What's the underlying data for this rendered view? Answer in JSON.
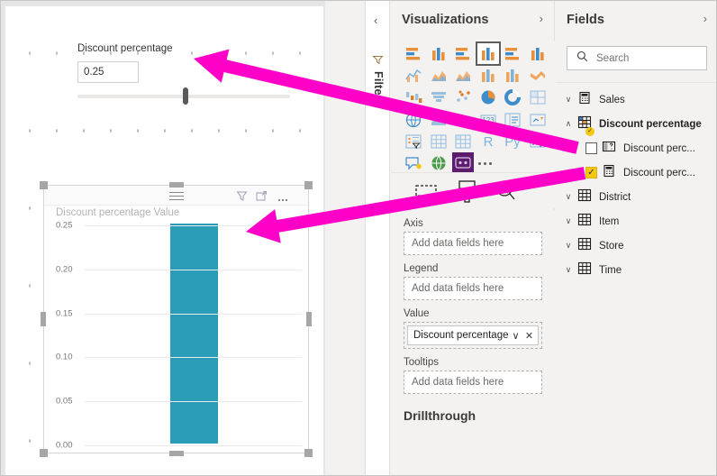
{
  "canvas": {
    "slicer": {
      "name": "slicer-visual",
      "title": "Discount percentage",
      "value": "0.25",
      "placeholder": "0.25"
    },
    "chart_visual": {
      "title": "Discount percentage Value",
      "header_icons": [
        "drag-handle-icon",
        "filter-icon",
        "focus-mode-icon",
        "more-options-icon"
      ]
    }
  },
  "chart_data": {
    "type": "bar",
    "title": "Discount percentage Value",
    "categories": [
      ""
    ],
    "values": [
      0.25
    ],
    "series": [
      {
        "name": "Discount percentage Value",
        "values": [
          0.25
        ]
      }
    ],
    "xlabel": "",
    "ylabel": "",
    "ylim": [
      0.0,
      0.25
    ],
    "yticks": [
      "0.00",
      "0.05",
      "0.10",
      "0.15",
      "0.20",
      "0.25"
    ],
    "ytick_values": [
      0.0,
      0.05,
      0.1,
      0.15,
      0.2,
      0.25
    ],
    "grid": true,
    "legend": "none",
    "bar_color": "#2b9cb8"
  },
  "filters_rail": {
    "collapse_label": "‹",
    "label": "Filters",
    "funnel_icon": "filter-icon"
  },
  "visualizations": {
    "title": "Visualizations",
    "expand_label": "›",
    "icons": [
      {
        "name": "stacked-bar-chart-icon",
        "selected": false
      },
      {
        "name": "stacked-column-chart-icon",
        "selected": false
      },
      {
        "name": "clustered-bar-chart-icon",
        "selected": false
      },
      {
        "name": "clustered-column-chart-icon",
        "selected": true
      },
      {
        "name": "hundred-percent-stacked-bar-chart-icon",
        "selected": false
      },
      {
        "name": "hundred-percent-stacked-column-chart-icon",
        "selected": false
      },
      {
        "name": "line-chart-icon",
        "selected": false
      },
      {
        "name": "area-chart-icon",
        "selected": false
      },
      {
        "name": "stacked-area-chart-icon",
        "selected": false
      },
      {
        "name": "line-and-stacked-column-chart-icon",
        "selected": false
      },
      {
        "name": "line-and-clustered-column-chart-icon",
        "selected": false
      },
      {
        "name": "ribbon-chart-icon",
        "selected": false
      },
      {
        "name": "waterfall-chart-icon",
        "selected": false
      },
      {
        "name": "funnel-chart-icon",
        "selected": false
      },
      {
        "name": "scatter-chart-icon",
        "selected": false
      },
      {
        "name": "pie-chart-icon",
        "selected": false
      },
      {
        "name": "donut-chart-icon",
        "selected": false
      },
      {
        "name": "treemap-icon",
        "selected": false
      },
      {
        "name": "map-icon",
        "selected": false
      },
      {
        "name": "filled-map-icon",
        "selected": false
      },
      {
        "name": "gauge-icon",
        "selected": false
      },
      {
        "name": "card-icon",
        "selected": false
      },
      {
        "name": "multi-row-card-icon",
        "selected": false
      },
      {
        "name": "kpi-icon",
        "selected": false
      },
      {
        "name": "slicer-icon",
        "selected": false
      },
      {
        "name": "table-icon",
        "selected": false
      },
      {
        "name": "matrix-icon",
        "selected": false
      },
      {
        "name": "r-script-visual-icon",
        "selected": false
      },
      {
        "name": "python-visual-icon",
        "selected": false
      },
      {
        "name": "key-influencers-icon",
        "selected": false
      },
      {
        "name": "qna-visual-icon",
        "selected": false
      },
      {
        "name": "arcgis-maps-icon",
        "selected": false
      },
      {
        "name": "custom-visual-icon",
        "selected": true
      }
    ],
    "more_visuals_label": "more-visuals-icon",
    "tabs": [
      {
        "name": "fields-tab",
        "icon": "fields-pane-icon",
        "active": true
      },
      {
        "name": "format-tab",
        "icon": "paint-roller-icon",
        "active": false
      },
      {
        "name": "analytics-tab",
        "icon": "magnifier-icon",
        "active": false
      }
    ],
    "wells": [
      {
        "label": "Axis",
        "placeholder": "Add data fields here",
        "chip": null
      },
      {
        "label": "Legend",
        "placeholder": "Add data fields here",
        "chip": null
      },
      {
        "label": "Value",
        "placeholder": "",
        "chip": "Discount percentage Va"
      },
      {
        "label": "Tooltips",
        "placeholder": "Add data fields here",
        "chip": null
      }
    ],
    "chip_menu_label": "∨",
    "chip_remove_label": "✕",
    "drillthrough_label": "Drillthrough"
  },
  "fields": {
    "title": "Fields",
    "expand_label": "›",
    "search": {
      "placeholder": "Search",
      "value": "",
      "icon": "search-icon"
    },
    "tree": [
      {
        "label": "Sales",
        "icon": "calculator-table-icon",
        "expanded": false,
        "chevron": "∨",
        "bold": false,
        "badge": false
      },
      {
        "label": "Discount percentage",
        "icon": "parameter-table-icon",
        "expanded": true,
        "chevron": "∧",
        "bold": true,
        "badge": true,
        "children": [
          {
            "label": "Discount perc...",
            "icon": "parameter-field-icon",
            "checked": false
          },
          {
            "label": "Discount perc...",
            "icon": "measure-icon",
            "checked": true
          }
        ]
      },
      {
        "label": "District",
        "icon": "table-icon",
        "expanded": false,
        "chevron": "∨",
        "bold": false,
        "badge": false
      },
      {
        "label": "Item",
        "icon": "table-icon",
        "expanded": false,
        "chevron": "∨",
        "bold": false,
        "badge": false
      },
      {
        "label": "Store",
        "icon": "table-icon",
        "expanded": false,
        "chevron": "∨",
        "bold": false,
        "badge": false
      },
      {
        "label": "Time",
        "icon": "table-icon",
        "expanded": false,
        "chevron": "∨",
        "bold": false,
        "badge": false
      }
    ]
  },
  "annotations": {
    "arrow_color": "#ff00c8",
    "arrows": [
      {
        "name": "annotation-arrow-to-slicer",
        "from": [
          640,
          163
        ],
        "to": [
          214,
          64
        ]
      },
      {
        "name": "annotation-arrow-to-chart",
        "from": [
          648,
          191
        ],
        "to": [
          272,
          256
        ]
      }
    ]
  }
}
